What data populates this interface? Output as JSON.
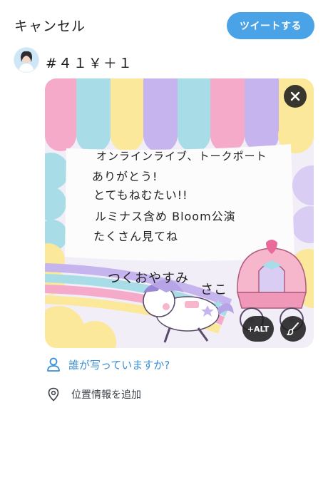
{
  "header": {
    "cancel_label": "キャンセル",
    "tweet_button_label": "ツイートする"
  },
  "composer": {
    "text": "#４１￥＋１"
  },
  "media": {
    "handwritten_lines": [
      "オンラインライブ、トークポート",
      "ありがとう!",
      "とてもねむたい!!",
      "ルミナス含め Bloom公演",
      "たくさん見てね",
      "つくおやすみ",
      "さこ"
    ],
    "alt_button_label": "+ALT"
  },
  "actions": {
    "tag_people_label": "誰が写っていますか?",
    "add_location_label": "位置情報を追加"
  },
  "colors": {
    "accent": "#4aa3e6",
    "link": "#3b8fd6"
  }
}
